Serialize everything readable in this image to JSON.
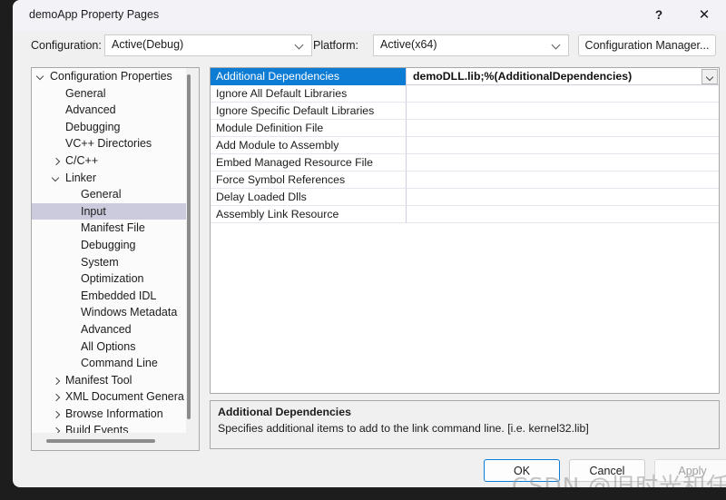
{
  "window": {
    "title": "demoApp Property Pages",
    "help_icon": "question-mark-icon",
    "close_icon": "close-icon"
  },
  "toolbar": {
    "configuration_label": "Configuration:",
    "configuration_value": "Active(Debug)",
    "platform_label": "Platform:",
    "platform_value": "Active(x64)",
    "configuration_manager_label": "Configuration Manager..."
  },
  "tree": {
    "items": [
      {
        "label": "Configuration Properties",
        "indent": 0,
        "expander": "open",
        "selected": false
      },
      {
        "label": "General",
        "indent": 1,
        "expander": "none",
        "selected": false
      },
      {
        "label": "Advanced",
        "indent": 1,
        "expander": "none",
        "selected": false
      },
      {
        "label": "Debugging",
        "indent": 1,
        "expander": "none",
        "selected": false
      },
      {
        "label": "VC++ Directories",
        "indent": 1,
        "expander": "none",
        "selected": false
      },
      {
        "label": "C/C++",
        "indent": 1,
        "expander": "closed",
        "selected": false
      },
      {
        "label": "Linker",
        "indent": 1,
        "expander": "open",
        "selected": false
      },
      {
        "label": "General",
        "indent": 2,
        "expander": "none",
        "selected": false
      },
      {
        "label": "Input",
        "indent": 2,
        "expander": "none",
        "selected": true
      },
      {
        "label": "Manifest File",
        "indent": 2,
        "expander": "none",
        "selected": false
      },
      {
        "label": "Debugging",
        "indent": 2,
        "expander": "none",
        "selected": false
      },
      {
        "label": "System",
        "indent": 2,
        "expander": "none",
        "selected": false
      },
      {
        "label": "Optimization",
        "indent": 2,
        "expander": "none",
        "selected": false
      },
      {
        "label": "Embedded IDL",
        "indent": 2,
        "expander": "none",
        "selected": false
      },
      {
        "label": "Windows Metadata",
        "indent": 2,
        "expander": "none",
        "selected": false
      },
      {
        "label": "Advanced",
        "indent": 2,
        "expander": "none",
        "selected": false
      },
      {
        "label": "All Options",
        "indent": 2,
        "expander": "none",
        "selected": false
      },
      {
        "label": "Command Line",
        "indent": 2,
        "expander": "none",
        "selected": false
      },
      {
        "label": "Manifest Tool",
        "indent": 1,
        "expander": "closed",
        "selected": false
      },
      {
        "label": "XML Document Genera",
        "indent": 1,
        "expander": "closed",
        "selected": false
      },
      {
        "label": "Browse Information",
        "indent": 1,
        "expander": "closed",
        "selected": false
      },
      {
        "label": "Build Events",
        "indent": 1,
        "expander": "closed",
        "selected": false
      }
    ]
  },
  "grid": {
    "rows": [
      {
        "name": "Additional Dependencies",
        "value": "demoDLL.lib;%(AdditionalDependencies)",
        "selected": true,
        "has_dropdown": true
      },
      {
        "name": "Ignore All Default Libraries",
        "value": "",
        "selected": false,
        "has_dropdown": false
      },
      {
        "name": "Ignore Specific Default Libraries",
        "value": "",
        "selected": false,
        "has_dropdown": false
      },
      {
        "name": "Module Definition File",
        "value": "",
        "selected": false,
        "has_dropdown": false
      },
      {
        "name": "Add Module to Assembly",
        "value": "",
        "selected": false,
        "has_dropdown": false
      },
      {
        "name": "Embed Managed Resource File",
        "value": "",
        "selected": false,
        "has_dropdown": false
      },
      {
        "name": "Force Symbol References",
        "value": "",
        "selected": false,
        "has_dropdown": false
      },
      {
        "name": "Delay Loaded Dlls",
        "value": "",
        "selected": false,
        "has_dropdown": false
      },
      {
        "name": "Assembly Link Resource",
        "value": "",
        "selected": false,
        "has_dropdown": false
      }
    ]
  },
  "description": {
    "title": "Additional Dependencies",
    "text": "Specifies additional items to add to the link command line. [i.e. kernel32.lib]"
  },
  "buttons": {
    "ok": "OK",
    "cancel": "Cancel",
    "apply": "Apply"
  },
  "watermark": {
    "text": "CSDN @旧时光和任天堂"
  },
  "colors": {
    "selection_blue": "#0c7cd5",
    "tree_selection": "#cbcbdd",
    "dialog_bg": "#f0f0f0",
    "focus_border": "#0c7cd5"
  }
}
